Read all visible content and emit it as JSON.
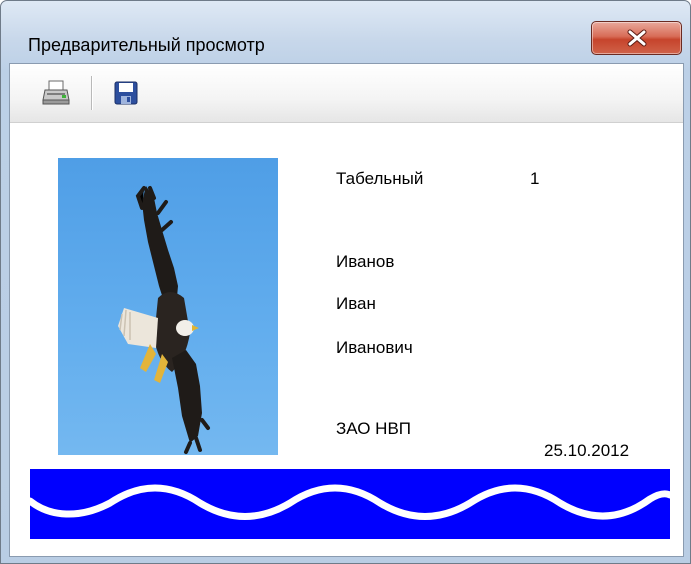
{
  "window": {
    "title": "Предварительный просмотр"
  },
  "toolbar": {
    "buttons": [
      {
        "name": "print",
        "icon": "printer-icon"
      },
      {
        "name": "save",
        "icon": "floppy-disk-icon"
      }
    ]
  },
  "report": {
    "photo_icon": "bald-eagle-photo",
    "tabel_label": "Табельный",
    "tabel_number": "1",
    "last_name": "Иванов",
    "first_name": "Иван",
    "patronymic": "Иванович",
    "company": "ЗАО НВП",
    "date": "25.10.2012",
    "colors": {
      "band": "#0000ff",
      "wave": "#ffffff"
    }
  }
}
